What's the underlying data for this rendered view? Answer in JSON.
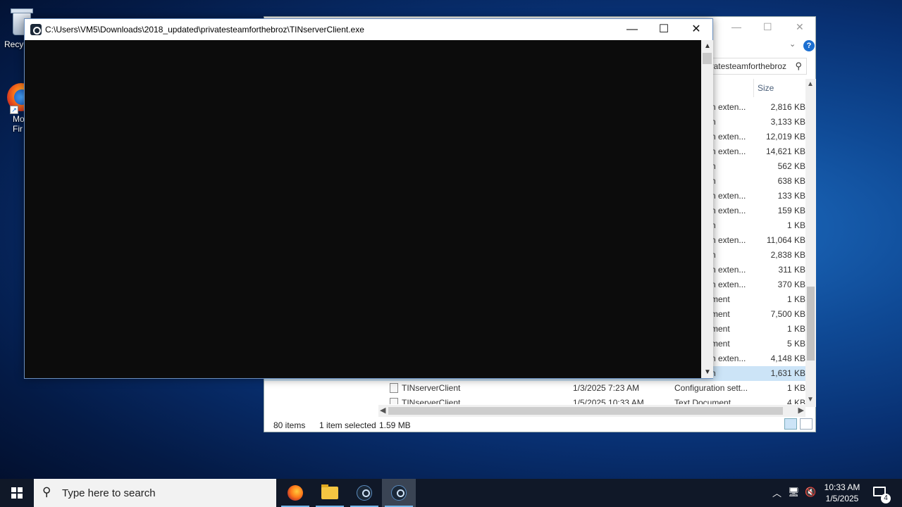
{
  "desktop": {
    "recycle_bin_label": "Recyc",
    "firefox_label_line1": "Mo",
    "firefox_label_line2": "Fir"
  },
  "explorer": {
    "search_value": "privatesteamforthebroz",
    "size_header": "Size",
    "rows": [
      {
        "type": "n exten...",
        "size": "2,816 KB"
      },
      {
        "type": "n",
        "size": "3,133 KB"
      },
      {
        "type": "n exten...",
        "size": "12,019 KB"
      },
      {
        "type": "n exten...",
        "size": "14,621 KB"
      },
      {
        "type": "n",
        "size": "562 KB"
      },
      {
        "type": "n",
        "size": "638 KB"
      },
      {
        "type": "n exten...",
        "size": "133 KB"
      },
      {
        "type": "n exten...",
        "size": "159 KB"
      },
      {
        "type": "n",
        "size": "1 KB"
      },
      {
        "type": "n exten...",
        "size": "11,064 KB"
      },
      {
        "type": "n",
        "size": "2,838 KB"
      },
      {
        "type": "n exten...",
        "size": "311 KB"
      },
      {
        "type": "n exten...",
        "size": "370 KB"
      },
      {
        "type": "ment",
        "size": "1 KB"
      },
      {
        "type": "ment",
        "size": "7,500 KB"
      },
      {
        "type": "ment",
        "size": "1 KB"
      },
      {
        "type": "ment",
        "size": "5 KB"
      },
      {
        "type": "n exten...",
        "size": "4,148 KB"
      },
      {
        "type": "n",
        "size": "1,631 KB"
      }
    ],
    "visible_files": [
      {
        "name": "TINserverClient",
        "date": "1/3/2025 7:23 AM",
        "type": "Configuration sett...",
        "size": "1 KB"
      },
      {
        "name": "TINserverClient",
        "date": "1/5/2025 10:33 AM",
        "type": "Text Document",
        "size": "4 KB"
      }
    ],
    "status": {
      "item_count": "80 items",
      "selection": "1 item selected",
      "selection_size": "1.59 MB"
    }
  },
  "console": {
    "title": "C:\\Users\\VM5\\Downloads\\2018_updated\\privatesteamforthebroz\\TINserverClient.exe",
    "minimize": "—",
    "maximize": "☐",
    "close": "✕"
  },
  "taskbar": {
    "search_placeholder": "Type here to search",
    "time": "10:33 AM",
    "date": "1/5/2025",
    "notification_count": "4"
  },
  "colors": {
    "taskbar": "#101828",
    "console_bg": "#0c0c0c",
    "selected_row": "#cce4f7",
    "accent": "#76b9ed"
  }
}
